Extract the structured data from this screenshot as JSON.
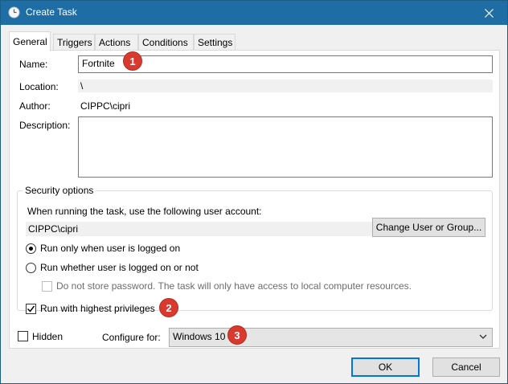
{
  "window": {
    "title": "Create Task"
  },
  "tabs": [
    {
      "label": "General"
    },
    {
      "label": "Triggers"
    },
    {
      "label": "Actions"
    },
    {
      "label": "Conditions"
    },
    {
      "label": "Settings"
    }
  ],
  "general": {
    "name_label": "Name:",
    "name_value": "Fortnite",
    "location_label": "Location:",
    "location_value": "\\",
    "author_label": "Author:",
    "author_value": "CIPPC\\cipri",
    "description_label": "Description:",
    "description_value": ""
  },
  "security": {
    "title": "Security options",
    "account_prompt": "When running the task, use the following user account:",
    "account_value": "CIPPC\\cipri",
    "change_user_label": "Change User or Group...",
    "run_logged_on_label": "Run only when user is logged on",
    "run_logged_on_selected": true,
    "run_whether_label": "Run whether user is logged on or not",
    "run_whether_selected": false,
    "no_store_password_label": "Do not store password.  The task will only have access to local computer resources.",
    "no_store_password_checked": false,
    "highest_priv_label": "Run with highest privileges",
    "highest_priv_checked": true
  },
  "bottom": {
    "hidden_label": "Hidden",
    "hidden_checked": false,
    "configure_label": "Configure for:",
    "configure_value": "Windows 10"
  },
  "buttons": {
    "ok": "OK",
    "cancel": "Cancel"
  },
  "annotations": [
    "1",
    "2",
    "3"
  ],
  "colors": {
    "titlebar": "#1f6da5",
    "badge": "#d93a2f",
    "default_button_border": "#0078d7"
  }
}
